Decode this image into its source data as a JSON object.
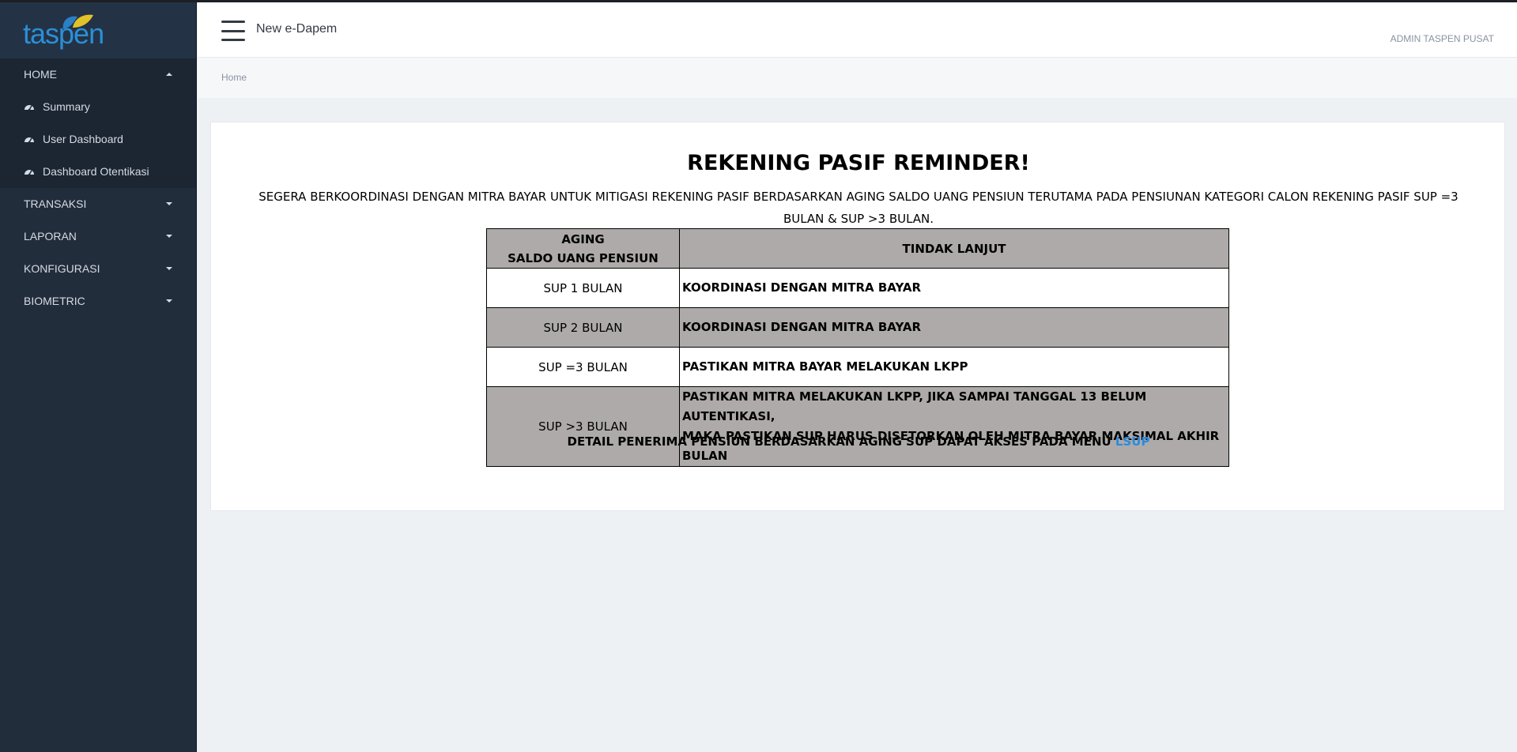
{
  "app": {
    "logo_text": "taspen",
    "title": "New e-Dapem",
    "user": "ADMIN TASPEN PUSAT"
  },
  "sidebar": {
    "home_label": "HOME",
    "home_subitems": [
      {
        "label": "Summary",
        "icon": "dashboard-icon"
      },
      {
        "label": "User Dashboard",
        "icon": "dashboard-icon"
      },
      {
        "label": "Dashboard Otentikasi",
        "icon": "dashboard-icon"
      }
    ],
    "menus": [
      {
        "label": "TRANSAKSI"
      },
      {
        "label": "LAPORAN"
      },
      {
        "label": "KONFIGURASI"
      },
      {
        "label": "BIOMETRIC"
      }
    ]
  },
  "breadcrumb": {
    "home": "Home"
  },
  "reminder": {
    "title": "REKENING PASIF REMINDER!",
    "text": "SEGERA BERKOORDINASI DENGAN MITRA BAYAR UNTUK MITIGASI REKENING PASIF BERDASARKAN AGING SALDO UANG PENSIUN TERUTAMA PADA PENSIUNAN KATEGORI CALON REKENING PASIF SUP =3 BULAN & SUP >3 BULAN.",
    "table": {
      "header_col1_line1": "AGING",
      "header_col1_line2": "SALDO UANG PENSIUN",
      "header_col2": "TINDAK LANJUT",
      "rows": [
        {
          "aging": "SUP 1 BULAN",
          "action": "KOORDINASI DENGAN MITRA BAYAR"
        },
        {
          "aging": "SUP 2 BULAN",
          "action": "KOORDINASI DENGAN MITRA BAYAR"
        },
        {
          "aging": "SUP =3 BULAN",
          "action": "PASTIKAN MITRA BAYAR MELAKUKAN LKPP"
        },
        {
          "aging": "SUP >3 BULAN",
          "action_line1": "PASTIKAN MITRA MELAKUKAN LKPP, JIKA SAMPAI TANGGAL 13 BELUM AUTENTIKASI,",
          "action_line2": "MAKA PASTIKAN SUP HARUS DISETORKAN OLEH MITRA BAYAR MAKSIMAL AKHIR BULAN"
        }
      ]
    },
    "footer_text": "DETAIL PENERIMA PENSIUN BERDASARKAN AGING SUP DAPAT AKSES PADA MENU ",
    "footer_link": "LSUP"
  },
  "colors": {
    "sidebar_bg": "#222d3c",
    "table_grey": "#aeaaaa",
    "link": "#2a8be0"
  }
}
